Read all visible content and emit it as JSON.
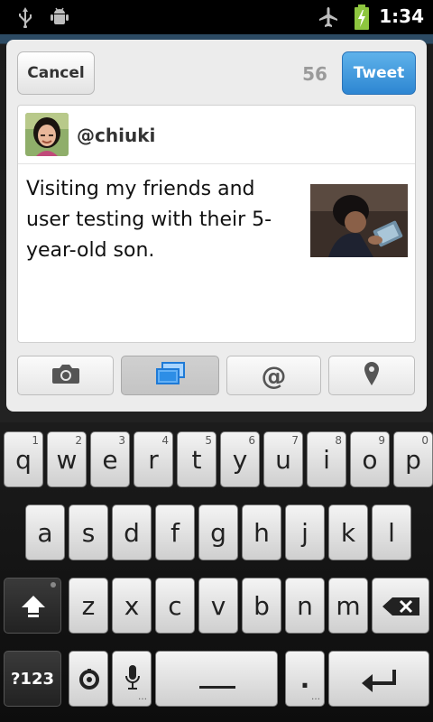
{
  "status_bar": {
    "time": "1:34",
    "icons": [
      "usb-icon",
      "android-debug-icon",
      "airplane-mode-icon",
      "battery-charging-icon"
    ]
  },
  "compose": {
    "cancel_label": "Cancel",
    "chars_remaining": "56",
    "tweet_label": "Tweet",
    "username": "@chiuki",
    "text": "Visiting my friends and user testing with their 5-year-old son.",
    "toolbar": [
      "camera-icon",
      "gallery-icon",
      "at-mention-icon",
      "location-pin-icon"
    ]
  },
  "keyboard": {
    "row1": [
      {
        "ch": "q",
        "num": "1"
      },
      {
        "ch": "w",
        "num": "2"
      },
      {
        "ch": "e",
        "num": "3"
      },
      {
        "ch": "r",
        "num": "4"
      },
      {
        "ch": "t",
        "num": "5"
      },
      {
        "ch": "y",
        "num": "6"
      },
      {
        "ch": "u",
        "num": "7"
      },
      {
        "ch": "i",
        "num": "8"
      },
      {
        "ch": "o",
        "num": "9"
      },
      {
        "ch": "p",
        "num": "0"
      }
    ],
    "row2": [
      "a",
      "s",
      "d",
      "f",
      "g",
      "h",
      "j",
      "k",
      "l"
    ],
    "row3": [
      "z",
      "x",
      "c",
      "v",
      "b",
      "n",
      "m"
    ],
    "symbols_label": "?123",
    "period_label": "."
  }
}
